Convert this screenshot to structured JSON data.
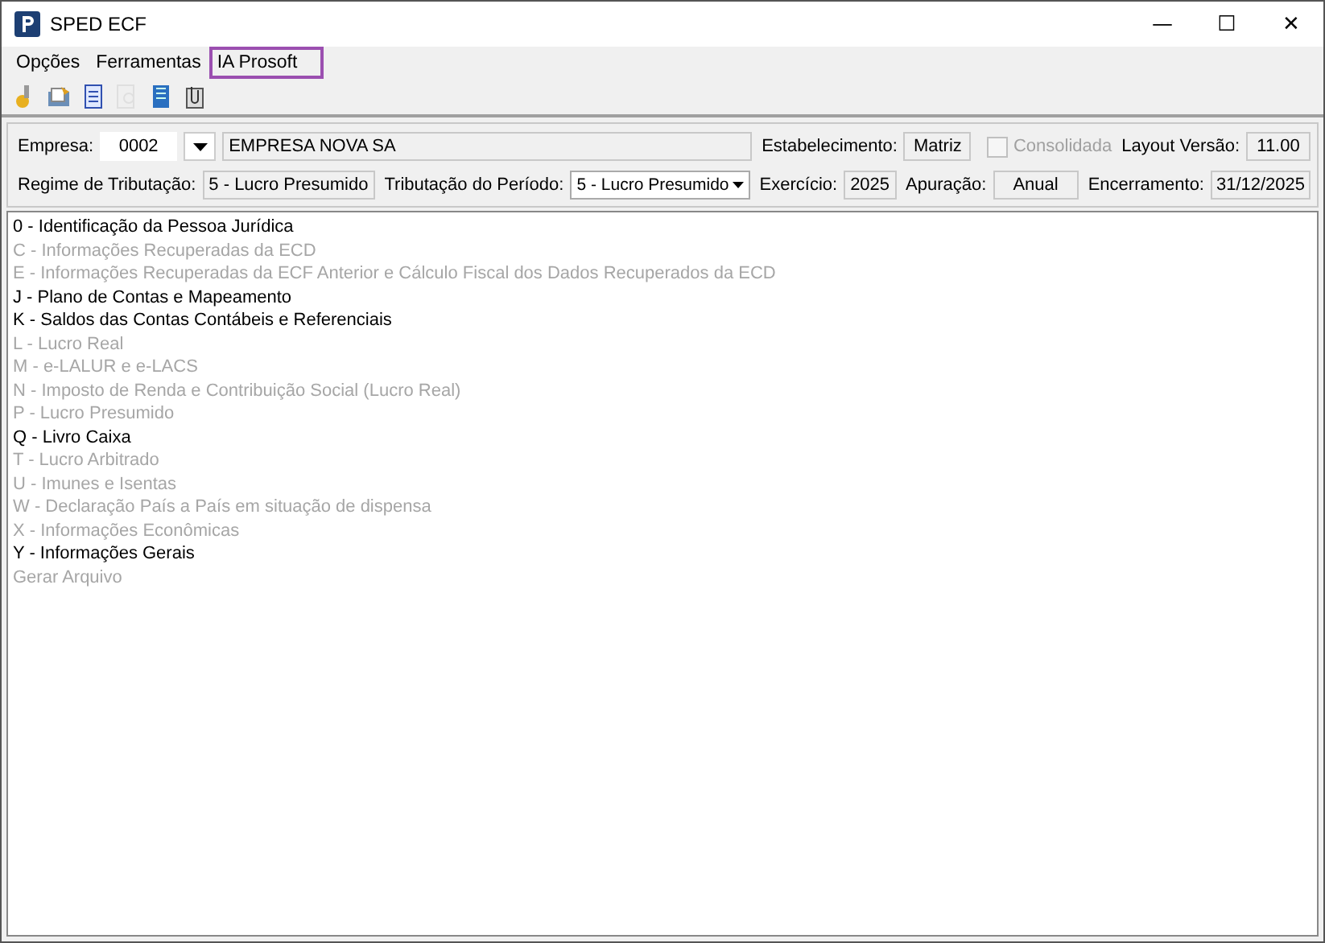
{
  "window": {
    "title": "SPED ECF",
    "controls": [
      "—",
      "☐",
      "✕"
    ]
  },
  "menu": [
    {
      "label": "Opções",
      "highlighted": false
    },
    {
      "label": "Ferramentas",
      "highlighted": false
    },
    {
      "label": "IA Prosoft",
      "highlighted": true
    }
  ],
  "toolbar": [
    {
      "kind": "key",
      "disabled": false
    },
    {
      "kind": "folder",
      "disabled": false
    },
    {
      "kind": "document",
      "disabled": false
    },
    {
      "kind": "preview",
      "disabled": true
    },
    {
      "kind": "save",
      "disabled": false
    },
    {
      "kind": "clip",
      "disabled": false
    }
  ],
  "form": {
    "empresa_label": "Empresa:",
    "empresa_code": "0002",
    "empresa_name": "EMPRESA NOVA SA",
    "estabelecimento_label": "Estabelecimento:",
    "estabelecimento": "Matriz",
    "consolidada": {
      "label": "Consolidada",
      "checked": false,
      "disabled": true
    },
    "layout_label": "Layout Versão:",
    "layout": "11.00",
    "regime_label": "Regime de Tributação:",
    "regime": "5 - Lucro Presumido",
    "periodo_label": "Tributação do Período:",
    "periodo": "5 - Lucro Presumido",
    "exercicio_label": "Exercício:",
    "exercicio": "2025",
    "apuracao_label": "Apuração:",
    "apuracao": "Anual",
    "encerramento_label": "Encerramento:",
    "encerramento": "31/12/2025"
  },
  "blocks": [
    {
      "label": "0 - Identificação da Pessoa Jurídica",
      "disabled": false
    },
    {
      "label": "C - Informações Recuperadas da ECD",
      "disabled": true
    },
    {
      "label": "E - Informações Recuperadas da ECF Anterior e Cálculo Fiscal dos Dados Recuperados da ECD",
      "disabled": true
    },
    {
      "label": "J - Plano de Contas e Mapeamento",
      "disabled": false
    },
    {
      "label": "K - Saldos das Contas Contábeis e Referenciais",
      "disabled": false
    },
    {
      "label": "L - Lucro Real",
      "disabled": true
    },
    {
      "label": "M - e-LALUR e e-LACS",
      "disabled": true
    },
    {
      "label": "N - Imposto de Renda e Contribuição Social (Lucro Real)",
      "disabled": true
    },
    {
      "label": "P - Lucro Presumido",
      "disabled": true
    },
    {
      "label": "Q - Livro Caixa",
      "disabled": false
    },
    {
      "label": "T - Lucro Arbitrado",
      "disabled": true
    },
    {
      "label": "U - Imunes e Isentas",
      "disabled": true
    },
    {
      "label": "W - Declaração País a País em situação de dispensa",
      "disabled": true
    },
    {
      "label": "X - Informações Econômicas",
      "disabled": true
    },
    {
      "label": "Y - Informações Gerais",
      "disabled": false
    },
    {
      "label": "Gerar Arquivo",
      "disabled": true
    }
  ]
}
